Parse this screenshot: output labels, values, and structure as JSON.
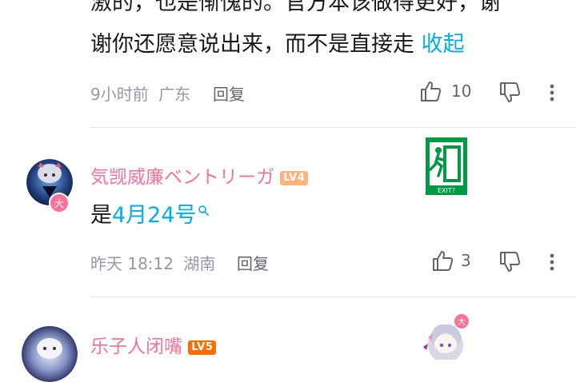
{
  "comment1": {
    "line1": "激的，也是惭愧的。官方本该做得更好，谢",
    "line2": "谢你还愿意说出来，而不是直接走",
    "collapse_label": "收起",
    "time": "9小时前",
    "location": "广东",
    "reply_label": "回复",
    "like_count": "10"
  },
  "comment2": {
    "username": "気觊威廉ベントリーガ",
    "level": "LV4",
    "text_prefix": "是",
    "link_text": "4月24号",
    "time": "昨天 18:12",
    "location": "湖南",
    "reply_label": "回复",
    "like_count": "3",
    "exit_sign_caption": "EXIT?"
  },
  "comment3": {
    "username": "乐子人闭嘴",
    "level": "LV5"
  },
  "colors": {
    "username": "#fb7299",
    "link": "#00aeec",
    "meta": "#9499a0",
    "exit_green": "#009944"
  },
  "icons": [
    "thumbs-up-icon",
    "thumbs-down-icon",
    "more-vertical-icon",
    "search-icon",
    "exit-sign-icon"
  ]
}
